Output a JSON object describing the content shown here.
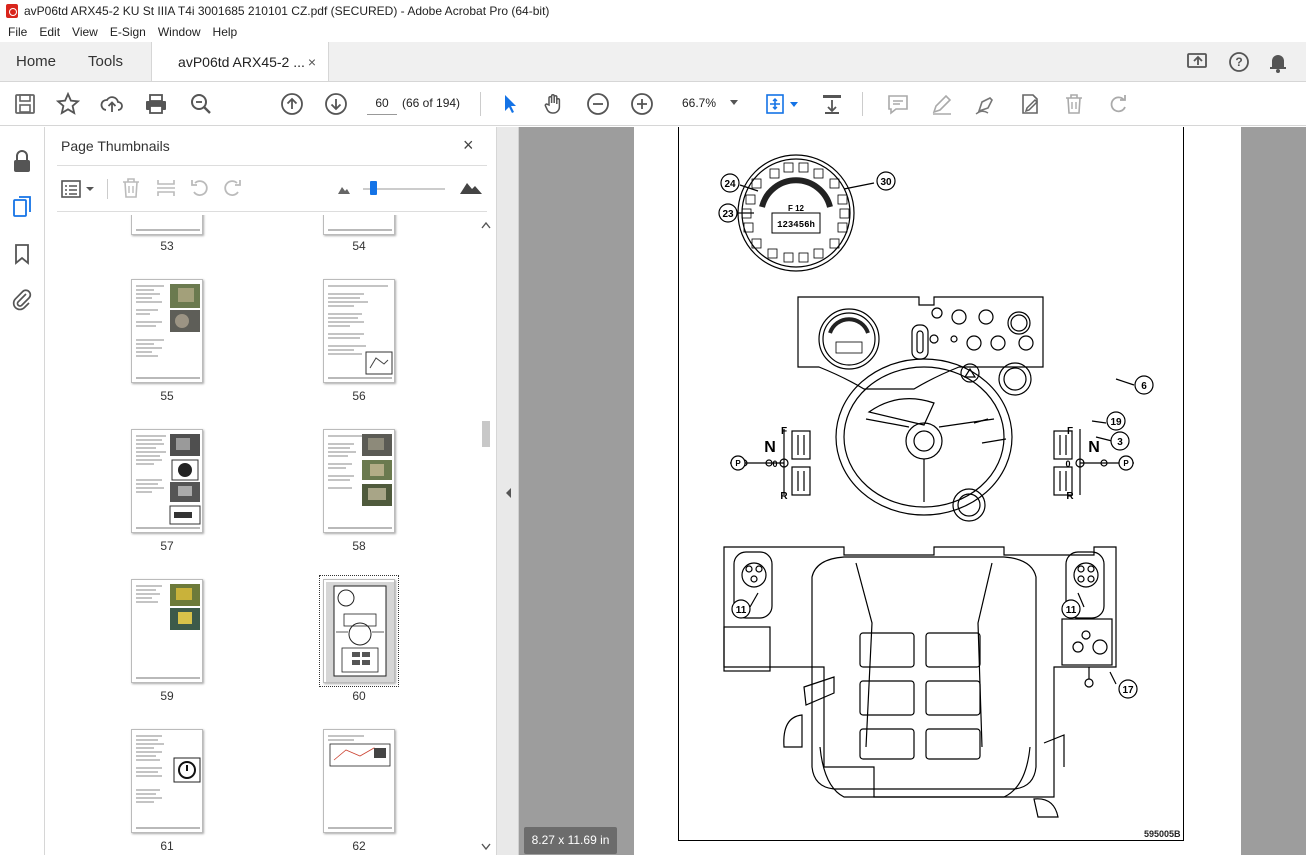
{
  "window": {
    "title": "avP06td ARX45-2 KU St IIIA T4i 3001685 210101 CZ.pdf (SECURED) - Adobe Acrobat Pro (64-bit)"
  },
  "menu": [
    "File",
    "Edit",
    "View",
    "E-Sign",
    "Window",
    "Help"
  ],
  "tabs": {
    "home": "Home",
    "tools": "Tools",
    "document": "avP06td ARX45-2 ...",
    "close": "×"
  },
  "toolbar": {
    "page_number": "60",
    "page_count": "(66 of 194)",
    "zoom": "66.7%"
  },
  "panel": {
    "title": "Page Thumbnails",
    "close": "×",
    "thumbnails": [
      {
        "label": "53"
      },
      {
        "label": "54"
      },
      {
        "label": "55"
      },
      {
        "label": "56"
      },
      {
        "label": "57"
      },
      {
        "label": "58"
      },
      {
        "label": "59"
      },
      {
        "label": "60",
        "selected": true
      },
      {
        "label": "61"
      },
      {
        "label": "62"
      }
    ]
  },
  "viewer": {
    "page_size": "8.27 x 11.69 in",
    "doc_code": "595005B",
    "callouts": [
      "24",
      "30",
      "23",
      "6",
      "19",
      "3",
      "11",
      "11",
      "17"
    ],
    "gauge_readout": "F 12",
    "hour_meter": "123456h",
    "shift_labels": {
      "n": "N",
      "f": "F",
      "zero": "0",
      "r": "R",
      "p": "P"
    }
  }
}
